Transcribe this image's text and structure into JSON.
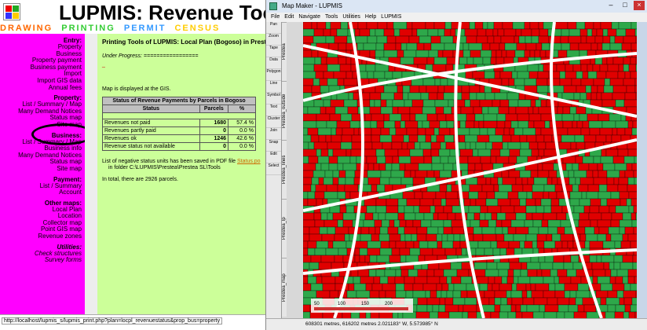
{
  "app_title": "LUPMIS: Revenue Too",
  "top_menu": [
    "DRAWING",
    "PRINTING",
    "PERMIT",
    "CENSUS"
  ],
  "top_menu_colors": [
    "#ff6600",
    "#33cc33",
    "#3399ff",
    "#ffcc00"
  ],
  "sidebar": {
    "sections": [
      {
        "title": "Entry:",
        "items": [
          "Property",
          "Business",
          "Property payment",
          "Business payment",
          "Import",
          "Import GIS data",
          "Annual fees"
        ]
      },
      {
        "title": "Property:",
        "items": [
          "List / Summary / Map",
          "Many Demand Notices",
          "Status map",
          "Site map"
        ]
      },
      {
        "title": "Business:",
        "items": [
          "List / Summary / Map",
          "Business info",
          "Many Demand Notices",
          "Status map",
          "Site map"
        ]
      },
      {
        "title": "Payment:",
        "items": [
          "List / Summary",
          "Account"
        ]
      },
      {
        "title": "Other maps:",
        "items": [
          "Local Plan",
          "Location",
          "Collector map",
          "Point GIS map",
          "Revenue zones"
        ]
      },
      {
        "title": "Utilities:",
        "items": [
          "Check structures",
          "Survey forms"
        ]
      }
    ]
  },
  "content": {
    "heading": "Printing Tools of LUPMIS: Local Plan (Bogoso) in Prestea I",
    "progress": "Under Progress: =================",
    "dash": "_",
    "map_msg": "Map is displayed at the GIS.",
    "table_title": "Status of Revenue Payments by Parcels in Bogoso",
    "col_status": "Status",
    "col_parcels": "Parcels",
    "col_pct": "%",
    "rows": [
      {
        "status": "Revenues not paid",
        "parcels": "1680",
        "pct": "57.4 %"
      },
      {
        "status": "Revenues partly paid",
        "parcels": "0",
        "pct": "0.0 %"
      },
      {
        "status": "Revenues ok",
        "parcels": "1246",
        "pct": "42.6 %"
      },
      {
        "status": "Revenue status not available",
        "parcels": "0",
        "pct": "0.0 %"
      }
    ],
    "neg_msg": "List of negative status units has been saved in PDF file",
    "neg_link": "Status.po",
    "folder": "in folder C:\\LUPMIS\\Prestea\\Prestea SL\\Tools",
    "total": "In total, there are 2926 parcels."
  },
  "status_url": "http://localhost/lupmis_s/lupmis_print.php?plan=locpl_revenuestatus&prop_bus=property",
  "map_maker": {
    "title": "Map Maker - LUPMIS",
    "menu": [
      "File",
      "Edit",
      "Navigate",
      "Tools",
      "Utilities",
      "Help",
      "LUPMIS"
    ],
    "tools": [
      "Pan",
      "Zoom",
      "Tape",
      "Data",
      "Polygon",
      "Line",
      "Symbol",
      "Text",
      "Cluster",
      "Join",
      "Snap",
      "Edit",
      "Select"
    ],
    "strip_labels": [
      "Prestea",
      "Prestea_outside",
      "Prestea_lines",
      "Prestea_lp",
      "Prestea_map"
    ],
    "status": "608301 metres, 616202 metres    2.021183° W, 5.573985° N",
    "scale": [
      "50",
      "100",
      "150",
      "200"
    ],
    "colors": {
      "paid": "#2ea84a",
      "not_paid": "#e00000",
      "road": "#ffffff"
    }
  }
}
